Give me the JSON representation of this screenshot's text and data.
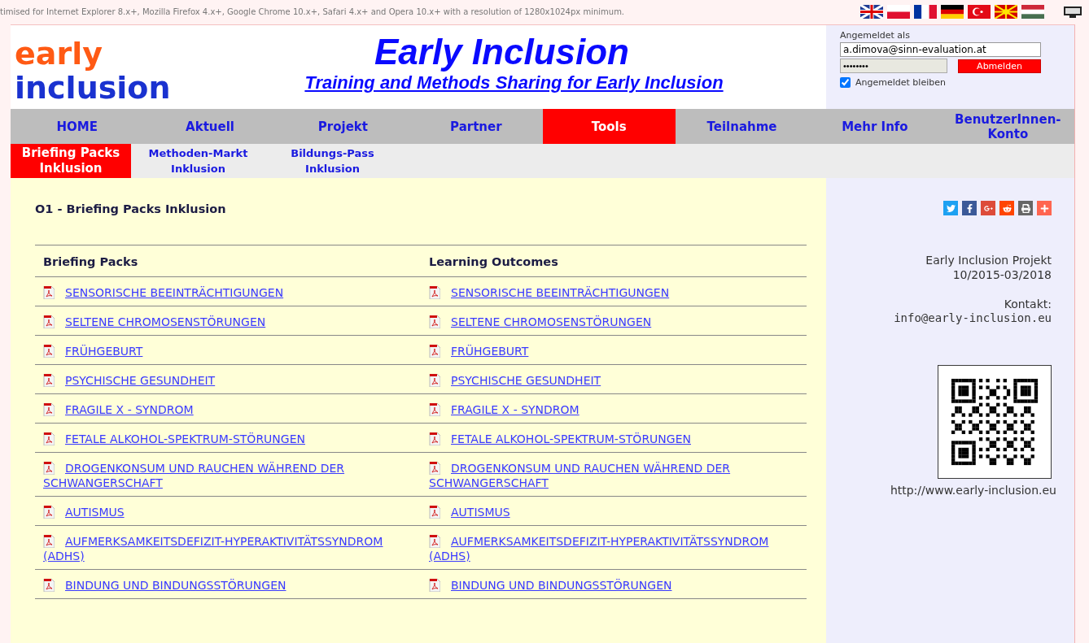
{
  "notice": "timised for Internet Explorer 8.x+, Mozilla Firefox 4.x+, Google Chrome 10.x+, Safari 4.x+ and Opera 10.x+ with a resolution of 1280x1024px minimum.",
  "flags": [
    {
      "kind": "uk"
    },
    {
      "kind": "pl"
    },
    {
      "kind": "fr"
    },
    {
      "kind": "de"
    },
    {
      "kind": "tr"
    },
    {
      "kind": "mk"
    },
    {
      "kind": "hu"
    }
  ],
  "logo": {
    "line_1": "early",
    "line_2": "inclusion"
  },
  "header": {
    "title": "Early Inclusion",
    "subtitle": "Training and Methods Sharing for Early Inclusion"
  },
  "login": {
    "label": "Angemeldet als",
    "email": "a.dimova@sinn-evaluation.at",
    "password": "••••••••",
    "logout_button": "Abmelden",
    "remember": {
      "label": "Angemeldet bleiben",
      "checked": true
    }
  },
  "nav": [
    {
      "label": "HOME",
      "selected": false
    },
    {
      "label": "Aktuell",
      "selected": false
    },
    {
      "label": "Projekt",
      "selected": false
    },
    {
      "label": "Partner",
      "selected": false
    },
    {
      "label": "Tools",
      "selected": true
    },
    {
      "label": "Teilnahme",
      "selected": false
    },
    {
      "label": "Mehr Info",
      "selected": false
    },
    {
      "label": "BenutzerInnen-Konto",
      "selected": false
    }
  ],
  "subnav": [
    {
      "label": "Briefing Packs Inklusion",
      "selected": true
    },
    {
      "label": "Methoden-Markt Inklusion",
      "selected": false
    },
    {
      "label": "Bildungs-Pass Inklusion",
      "selected": false
    }
  ],
  "page_title": "O1 - Briefing Packs Inklusion",
  "table": {
    "columns": [
      "Briefing Packs",
      "Learning Outcomes"
    ],
    "rows": [
      [
        "SENSORISCHE BEEINTRÄCHTIGUNGEN",
        "SENSORISCHE BEEINTRÄCHTIGUNGEN"
      ],
      [
        "SELTENE CHROMOSENSTÖRUNGEN",
        "SELTENE CHROMOSENSTÖRUNGEN"
      ],
      [
        "FRÜHGEBURT",
        "FRÜHGEBURT"
      ],
      [
        "PSYCHISCHE GESUNDHEIT",
        "PSYCHISCHE GESUNDHEIT"
      ],
      [
        "FRAGILE X - SYNDROM",
        "FRAGILE X - SYNDROM"
      ],
      [
        "FETALE ALKOHOL-SPEKTRUM-STÖRUNGEN",
        "FETALE ALKOHOL-SPEKTRUM-STÖRUNGEN"
      ],
      [
        "DROGENKONSUM UND RAUCHEN WÄHREND DER SCHWANGERSCHAFT",
        "DROGENKONSUM UND RAUCHEN WÄHREND DER SCHWANGERSCHAFT"
      ],
      [
        "AUTISMUS",
        "AUTISMUS"
      ],
      [
        "AUFMERKSAMKEITSDEFIZIT-HYPERAKTIVITÄTSSYNDROM (ADHS)",
        "AUFMERKSAMKEITSDEFIZIT-HYPERAKTIVITÄTSSYNDROM (ADHS)"
      ],
      [
        "BINDUNG UND BINDUNGSSTÖRUNGEN",
        "BINDUNG UND BINDUNGSSTÖRUNGEN"
      ]
    ]
  },
  "share": [
    {
      "kind": "twitter",
      "color": "#1da1f2"
    },
    {
      "kind": "facebook",
      "color": "#3b5998"
    },
    {
      "kind": "googleplus",
      "color": "#dd4b39"
    },
    {
      "kind": "reddit",
      "color": "#ff4500"
    },
    {
      "kind": "print",
      "color": "#666666"
    },
    {
      "kind": "more",
      "color": "#ff6550"
    }
  ],
  "sidebar": {
    "project": "Early Inclusion Projekt",
    "period": "10/2015-03/2018",
    "contact_label": "Kontakt:",
    "email": "info@early-inclusion.eu",
    "url": "http://www.early-inclusion.eu"
  }
}
